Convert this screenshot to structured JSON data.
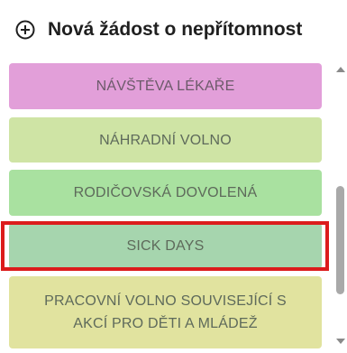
{
  "header": {
    "icon": "plus-circle-icon",
    "title": "Nová žádost o nepřítomnost"
  },
  "absence_types": [
    {
      "label": "NÁVŠTĚVA LÉKAŘE",
      "color": "#e29fd9"
    },
    {
      "label": "NÁHRADNÍ VOLNO",
      "color": "#cfe4a5"
    },
    {
      "label": "RODIČOVSKÁ DOVOLENÁ",
      "color": "#a9e1a0"
    },
    {
      "label": "SICK DAYS",
      "color": "#a6d5ae",
      "selected": true
    },
    {
      "label_line1": "PRACOVNÍ VOLNO SOUVISEJÍCÍ S",
      "label_line2": "AKCÍ PRO DĚTI A MLÁDEŽ",
      "color": "#e1e39f"
    }
  ],
  "highlight_color": "#dc1c1c",
  "scrollbar": {
    "up_icon": "scroll-up-arrow-icon",
    "down_icon": "scroll-down-arrow-icon"
  }
}
